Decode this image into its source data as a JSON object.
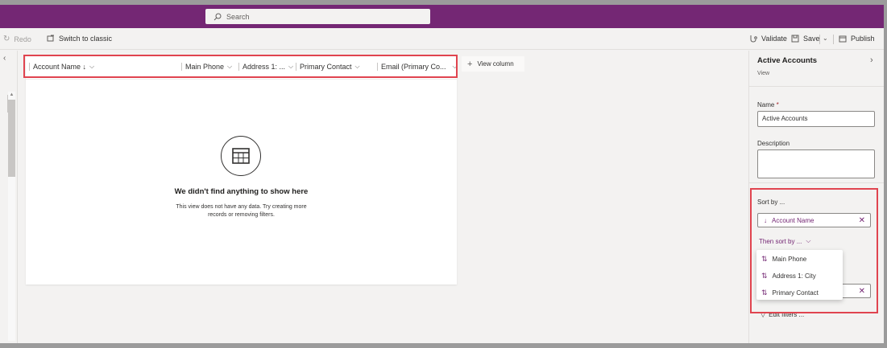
{
  "header": {
    "search_placeholder": "Search"
  },
  "commandbar": {
    "redo": "Redo",
    "switch_classic": "Switch to classic",
    "validate": "Validate",
    "save": "Save",
    "publish": "Publish"
  },
  "grid": {
    "columns": [
      {
        "label": "Account Name ↓"
      },
      {
        "label": "Main Phone"
      },
      {
        "label": "Address 1: ..."
      },
      {
        "label": "Primary Contact"
      },
      {
        "label": "Email (Primary Co..."
      }
    ],
    "empty_title": "We didn't find anything to show here",
    "empty_subtitle": "This view does not have any data. Try creating more records or removing filters.",
    "view_column": "View column"
  },
  "panel": {
    "title": "Active Accounts",
    "subtitle": "View",
    "name_label": "Name",
    "name_required": "*",
    "name_value": "Active Accounts",
    "description_label": "Description",
    "description_value": "",
    "sort_label": "Sort by ...",
    "sort_value": "Account Name",
    "then_sort_label": "Then sort by ...",
    "then_sort_options": [
      {
        "label": "Main Phone"
      },
      {
        "label": "Address 1: City"
      },
      {
        "label": "Primary Contact"
      }
    ],
    "edit_filters": "Edit filters ..."
  },
  "colors": {
    "brand": "#742774",
    "highlight": "#e0444f"
  }
}
